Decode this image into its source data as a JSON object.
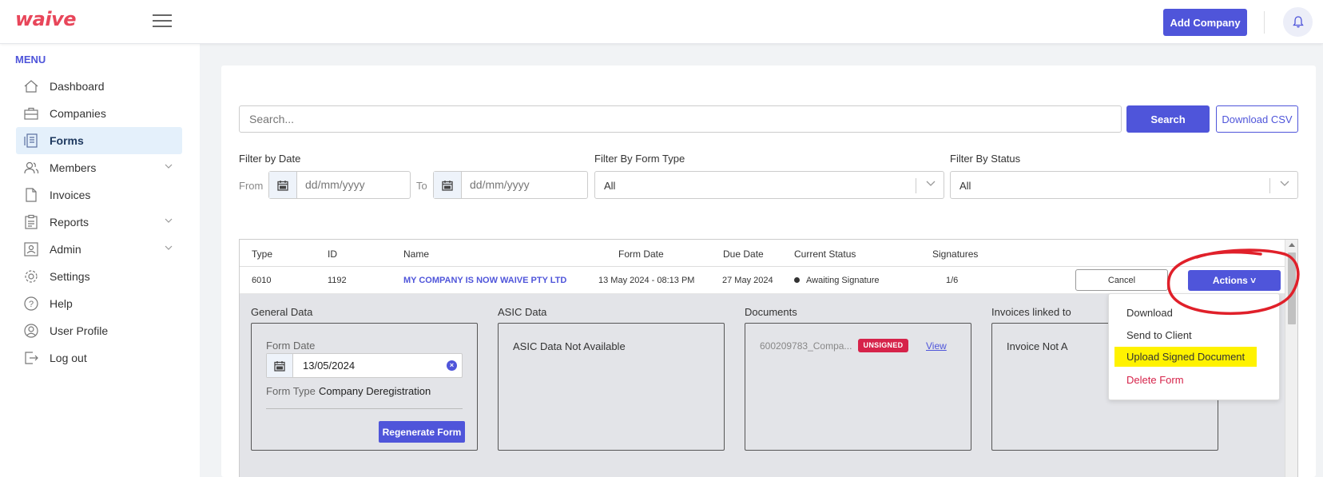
{
  "header": {
    "logo": "waive",
    "add_company_label": "Add Company"
  },
  "sidebar": {
    "menu_title": "MENU",
    "items": [
      {
        "label": "Dashboard"
      },
      {
        "label": "Companies"
      },
      {
        "label": "Forms"
      },
      {
        "label": "Members"
      },
      {
        "label": "Invoices"
      },
      {
        "label": "Reports"
      },
      {
        "label": "Admin"
      },
      {
        "label": "Settings"
      },
      {
        "label": "Help"
      },
      {
        "label": "User Profile"
      },
      {
        "label": "Log out"
      }
    ]
  },
  "search": {
    "placeholder": "Search...",
    "button_label": "Search",
    "csv_label": "Download CSV"
  },
  "filters": {
    "date_label": "Filter by Date",
    "from_label": "From",
    "to_label": "To",
    "date_placeholder": "dd/mm/yyyy",
    "form_type_label": "Filter By Form Type",
    "form_type_value": "All",
    "status_label": "Filter By Status",
    "status_value": "All"
  },
  "table": {
    "headers": {
      "type": "Type",
      "id": "ID",
      "name": "Name",
      "form_date": "Form Date",
      "due_date": "Due Date",
      "status": "Current Status",
      "signatures": "Signatures"
    },
    "row": {
      "type": "6010",
      "id": "1192",
      "name": "MY COMPANY IS NOW WAIVE PTY LTD",
      "form_date": "13 May 2024 - 08:13 PM",
      "due_date": "27 May 2024",
      "status": "Awaiting Signature",
      "signatures": "1/6",
      "cancel_label": "Cancel",
      "actions_label": "Actions ˅"
    }
  },
  "details": {
    "general": {
      "title": "General Data",
      "form_date_label": "Form Date",
      "form_date_value": "13/05/2024",
      "form_type_label": "Form Type",
      "form_type_value": "Company Deregistration",
      "regenerate_label": "Regenerate Form"
    },
    "asic": {
      "title": "ASIC Data",
      "text": "ASIC Data Not Available"
    },
    "documents": {
      "title": "Documents",
      "filename": "600209783_Compa...",
      "badge": "UNSIGNED",
      "view_label": "View"
    },
    "invoices": {
      "title": "Invoices linked to",
      "text": "Invoice Not A"
    }
  },
  "dropdown": {
    "items": [
      {
        "label": "Download"
      },
      {
        "label": "Send to Client"
      },
      {
        "label": "Upload Signed Document"
      },
      {
        "label": "Delete Form"
      }
    ]
  },
  "colors": {
    "accent": "#4f55da",
    "danger": "#d6234a",
    "highlight": "#fff200",
    "annotation": "#e0202a"
  }
}
